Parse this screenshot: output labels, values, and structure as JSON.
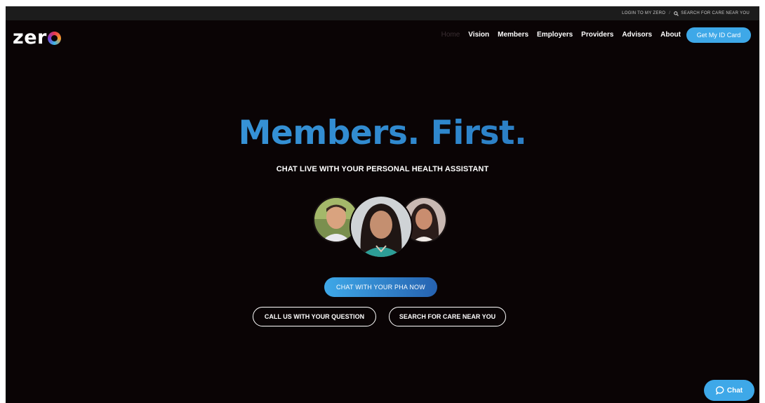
{
  "topbar": {
    "login": "LOGIN TO MY ZERO",
    "separator": "/",
    "search": "SEARCH FOR CARE NEAR YOU"
  },
  "logo": {
    "text": "zer"
  },
  "nav": {
    "items": [
      "Home",
      "Vision",
      "Members",
      "Employers",
      "Providers",
      "Advisors",
      "About"
    ],
    "id_card_button": "Get My ID Card"
  },
  "hero": {
    "title": "Members. First.",
    "subtitle": "CHAT LIVE WITH YOUR PERSONAL HEALTH ASSISTANT",
    "chat_button": "CHAT WITH YOUR PHA NOW",
    "call_button": "CALL US WITH YOUR QUESTION",
    "search_button": "SEARCH FOR CARE NEAR YOU"
  },
  "chat_widget": {
    "label": "Chat"
  },
  "colors": {
    "accent": "#3ea8e8",
    "title_blue": "#2f8ed3",
    "background": "#0a0405"
  },
  "icons": [
    "search-icon",
    "chat-bubble-icon"
  ]
}
